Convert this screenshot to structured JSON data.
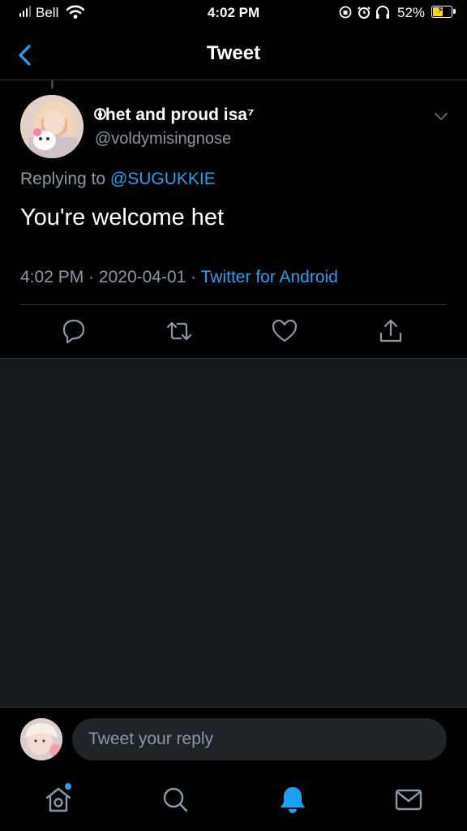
{
  "status_bar": {
    "carrier": "Bell",
    "time": "4:02 PM",
    "battery_percent": "52%",
    "battery_level": 0.52,
    "icons": [
      "signal-icon",
      "wifi-icon",
      "screen-lock-icon",
      "alarm-icon",
      "headphones-icon",
      "battery-charging-icon"
    ]
  },
  "header": {
    "title": "Tweet",
    "back_icon": "back-chevron-icon"
  },
  "tweet": {
    "display_name": "🅯het and proud isa⁷",
    "handle": "@voldymisingnose",
    "replying_prefix": "Replying to",
    "replying_to": "@SUGUKKIE",
    "text": "You're welcome het",
    "time": "4:02 PM",
    "date_sep": "·",
    "date": "2020-04-01",
    "source_sep": "·",
    "source": "Twitter for Android",
    "actions": [
      "reply-icon",
      "retweet-icon",
      "like-icon",
      "share-icon"
    ]
  },
  "reply": {
    "placeholder": "Tweet your reply"
  },
  "tabs": {
    "items": [
      "home-icon",
      "search-icon",
      "notifications-icon",
      "messages-icon"
    ],
    "active": "notifications-icon",
    "home_has_update": true
  },
  "colors": {
    "accent": "#1da1f2",
    "background": "#000000",
    "secondary_text": "#8b98a5",
    "empty_area": "#15181c",
    "battery": "#ffd60a"
  }
}
